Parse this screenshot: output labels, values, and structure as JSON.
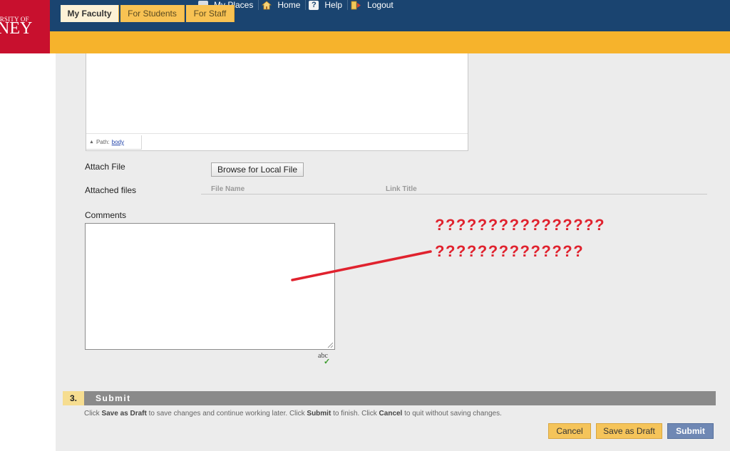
{
  "header": {
    "logo_line1": "ERSITY OF",
    "logo_line2": "NEY",
    "nav": [
      {
        "label": "My Places",
        "icon": "person-icon"
      },
      {
        "label": "Home",
        "icon": "house-icon"
      },
      {
        "label": "Help",
        "icon": "help-icon"
      },
      {
        "label": "Logout",
        "icon": "logout-icon"
      }
    ],
    "tabs": [
      {
        "label": "My Faculty",
        "active": true
      },
      {
        "label": "For Students",
        "active": false
      },
      {
        "label": "For Staff",
        "active": false
      }
    ]
  },
  "editor": {
    "path_label": "Path:",
    "path_value": "body"
  },
  "form": {
    "attach_file_label": "Attach File",
    "browse_button": "Browse for Local File",
    "attached_files_label": "Attached files",
    "file_name_header": "File Name",
    "link_title_header": "Link Title",
    "comments_label": "Comments",
    "spellcheck_label": "abc"
  },
  "annotation": {
    "line1": "????????????????",
    "line2": "??????????????",
    "color": "#e0222e"
  },
  "submit_section": {
    "number": "3.",
    "title": "Submit",
    "help": {
      "p1": "Click ",
      "b1": "Save as Draft",
      "p2": " to save changes and continue working later. Click ",
      "b2": "Submit",
      "p3": " to finish. Click ",
      "b3": "Cancel",
      "p4": " to quit without saving changes."
    },
    "buttons": {
      "cancel": "Cancel",
      "save_draft": "Save as Draft",
      "submit": "Submit"
    }
  },
  "colors": {
    "header_bg": "#1a4470",
    "tab_bar": "#f6b32c",
    "logo_red": "#c8102e",
    "content_bg": "#ececec"
  }
}
